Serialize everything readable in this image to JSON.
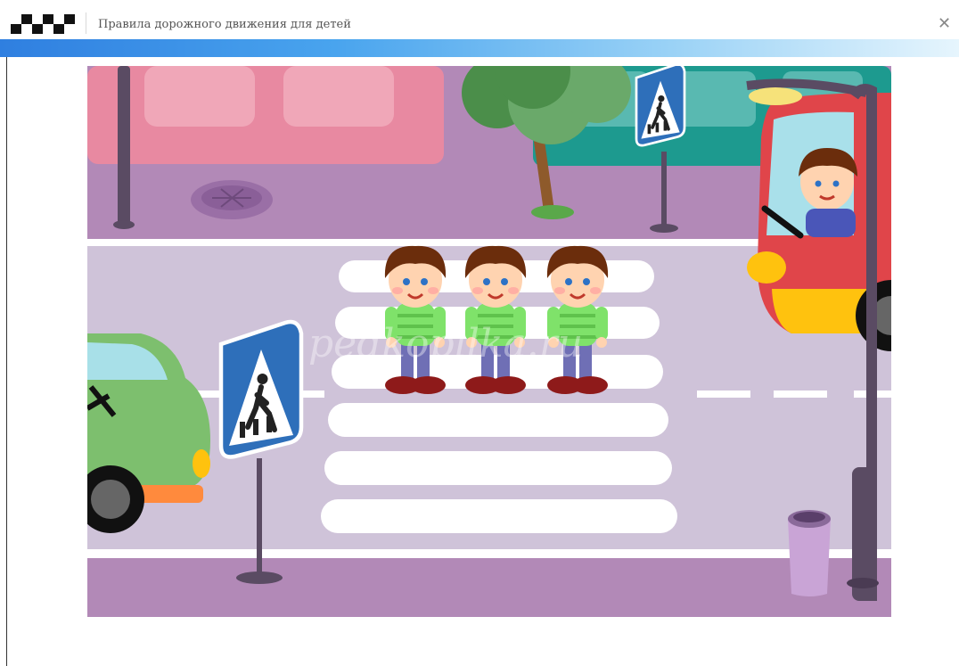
{
  "window": {
    "title": "Правила дорожного движения для детей",
    "close_symbol": "✕"
  },
  "icons": {
    "logo": "checkered-flag-icon",
    "close": "close-icon"
  },
  "scene": {
    "watermark": "pedkopilka.ru",
    "characters": "three-boys-crossing",
    "signs": "pedestrian-crossing-sign"
  },
  "colors": {
    "accent": "#2f7fe0",
    "sidewalk": "#b289b7",
    "road": "#cfc3d9",
    "sign_blue": "#2e6fba"
  }
}
